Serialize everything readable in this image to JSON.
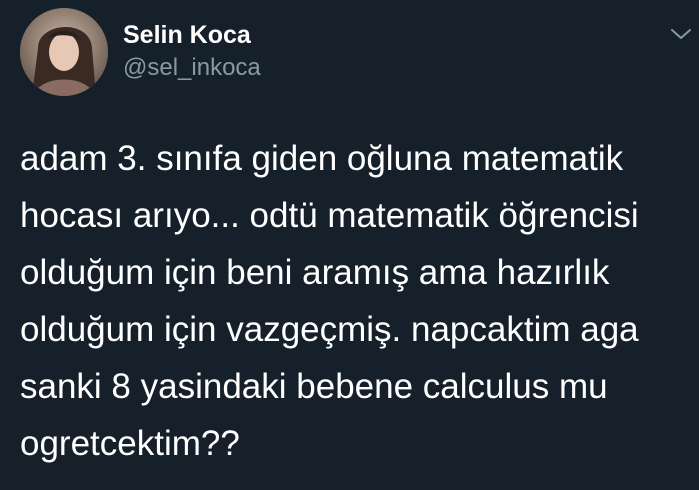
{
  "user": {
    "display_name": "Selin Koca",
    "handle": "@sel_inkoca",
    "avatar_icon": "profile-photo",
    "menu_icon": "chevron-down-icon"
  },
  "tweet": {
    "lines": [
      "adam 3. sınıfa giden oğluna matematik",
      "hocası arıyo... odtü matematik öğrencisi",
      "olduğum için beni aramış ama hazırlık",
      "olduğum için vazgeçmiş. napcaktim aga",
      "sanki 8 yasindaki bebene calculus mu",
      "ogretcektim??"
    ]
  },
  "colors": {
    "background": "#15202b",
    "name": "#ffffff",
    "handle": "#8899a6",
    "text": "#ffffff"
  }
}
